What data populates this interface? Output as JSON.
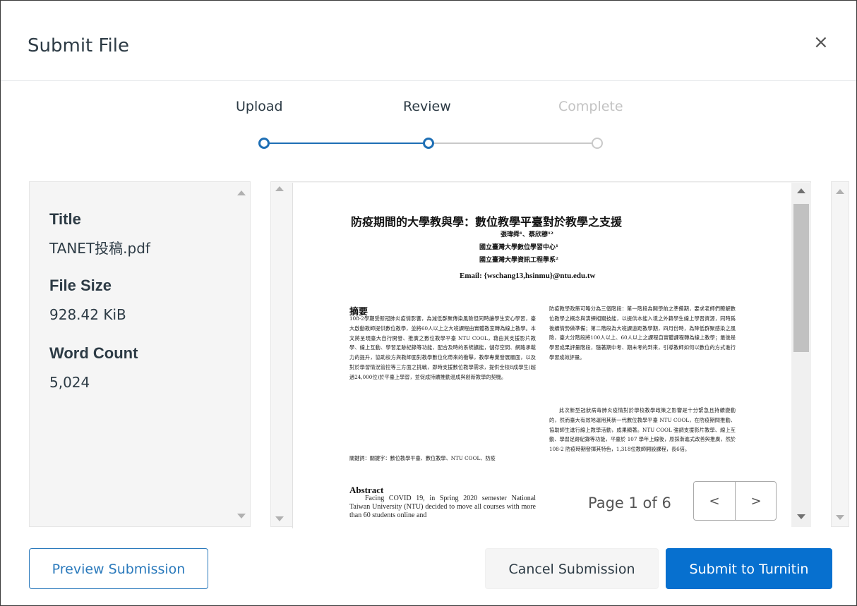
{
  "modal": {
    "title": "Submit File",
    "close_label": "×"
  },
  "steps": [
    {
      "label": "Upload",
      "state": "done"
    },
    {
      "label": "Review",
      "state": "current"
    },
    {
      "label": "Complete",
      "state": "pending"
    }
  ],
  "file_info": {
    "title_label": "Title",
    "title_value": "TANET投稿.pdf",
    "size_label": "File Size",
    "size_value": "928.42 KiB",
    "words_label": "Word Count",
    "words_value": "5,024"
  },
  "document": {
    "title": "防疫期間的大學教與學：數位教學平臺對於教學之支援",
    "authors": "張瑋舜¹、蔡欣穆¹²",
    "affil1": "國立臺灣大學數位學習中心¹",
    "affil2": "國立臺灣大學資訊工程學系²",
    "email": "Email: {wschang13,hsinmu}@ntu.edu.tw",
    "abstract_zh_heading": "摘要",
    "abstract_zh": "108-2學期受新冠肺炎疫情影響，為減低群聚傳染風險但同時讓學生安心學習，臺大啟動教師提供數位教學，並將60人以上之大班課程由實體教室轉為線上教學。本文將呈現臺大自行開發、推廣之數位教學平臺 NTU COOL，藉由其支援影片教學、線上互動、學習足跡紀錄等功能，配合及時的系統擴能，儲存空間、網路承載力的提升，協助校方與教師面對教學數位化帶來的衝擊，教學專業發展層面，以及對於學習情況管控等三方面之挑戰，即時支援數位教學需求，提供全校8成學生(超過24,000位)於平臺上學習，並促成持續推動混成與創新教學的契機。",
    "keywords": "關鍵詞：關鍵字：數位教學平臺、數位教學、NTU COOL、防疫",
    "abstract_en_heading": "Abstract",
    "abstract_en": "Facing COVID 19, in Spring 2020 semester National Taiwan University (NTU) decided to move all courses with more than 60 students online and",
    "col2_p1": "防疫教學政策可略分為三個階段：第一階段為開學前之準備期，要求老師們瞭解數位教學之概念與演練相關技能，以提供本能入境之外籍學生線上學習資源，同時爲後續情勢做準備；第二階段為大班課遠距教學期，四月份時，為降低群聚感染之風險，臺大分階段將100人以上、60人以上之課程自實體課程轉為線上教學；最後是學習成果評量階段，隨著期中考、期末考的到來，引導教師如何以數位的方式進行學習成效評量。",
    "col2_p2": "此次新型冠狀病毒肺炎疫情對於學校教學政策之影響是十分緊急且持續變動的，然而臺大有效地運用其新一代數位教學平臺 NTU COOL，在防疫期間推動、協助師生進行線上教學活動，成果顯著。NTU COOL 強調支援影片教學、線上互動、學習足跡紀錄等功能，平臺於 107 學年上線後，原採漸進式改善與推廣，然於 108-2 防疫時期發揮其特色，1,318位教師開設課程，長6倍。"
  },
  "pager": {
    "text": "Page 1 of 6",
    "prev": "<",
    "next": ">"
  },
  "buttons": {
    "preview": "Preview Submission",
    "cancel": "Cancel Submission",
    "submit": "Submit to Turnitin"
  },
  "colors": {
    "accent": "#2b7abc",
    "primary": "#0770cf",
    "step_done": "#1e6fb5",
    "step_pending": "#c9c9c9"
  }
}
